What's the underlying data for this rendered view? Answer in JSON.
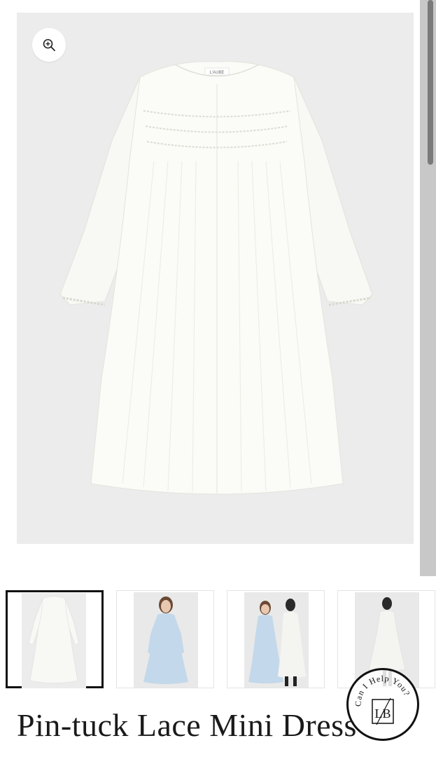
{
  "product": {
    "title": "Pin-tuck Lace Mini Dress",
    "main_image": {
      "label": "L'AUBE",
      "zoom_icon": "zoom-in-icon"
    },
    "thumbnails": [
      {
        "selected": true
      },
      {
        "selected": false
      },
      {
        "selected": false
      },
      {
        "selected": false
      }
    ]
  },
  "help_badge": {
    "text": "Can I Help You?",
    "monogram": "LB"
  },
  "colors": {
    "hero_bg": "#ececec",
    "scrollbar": "#7a7a7a",
    "title": "#1a1a1a"
  }
}
